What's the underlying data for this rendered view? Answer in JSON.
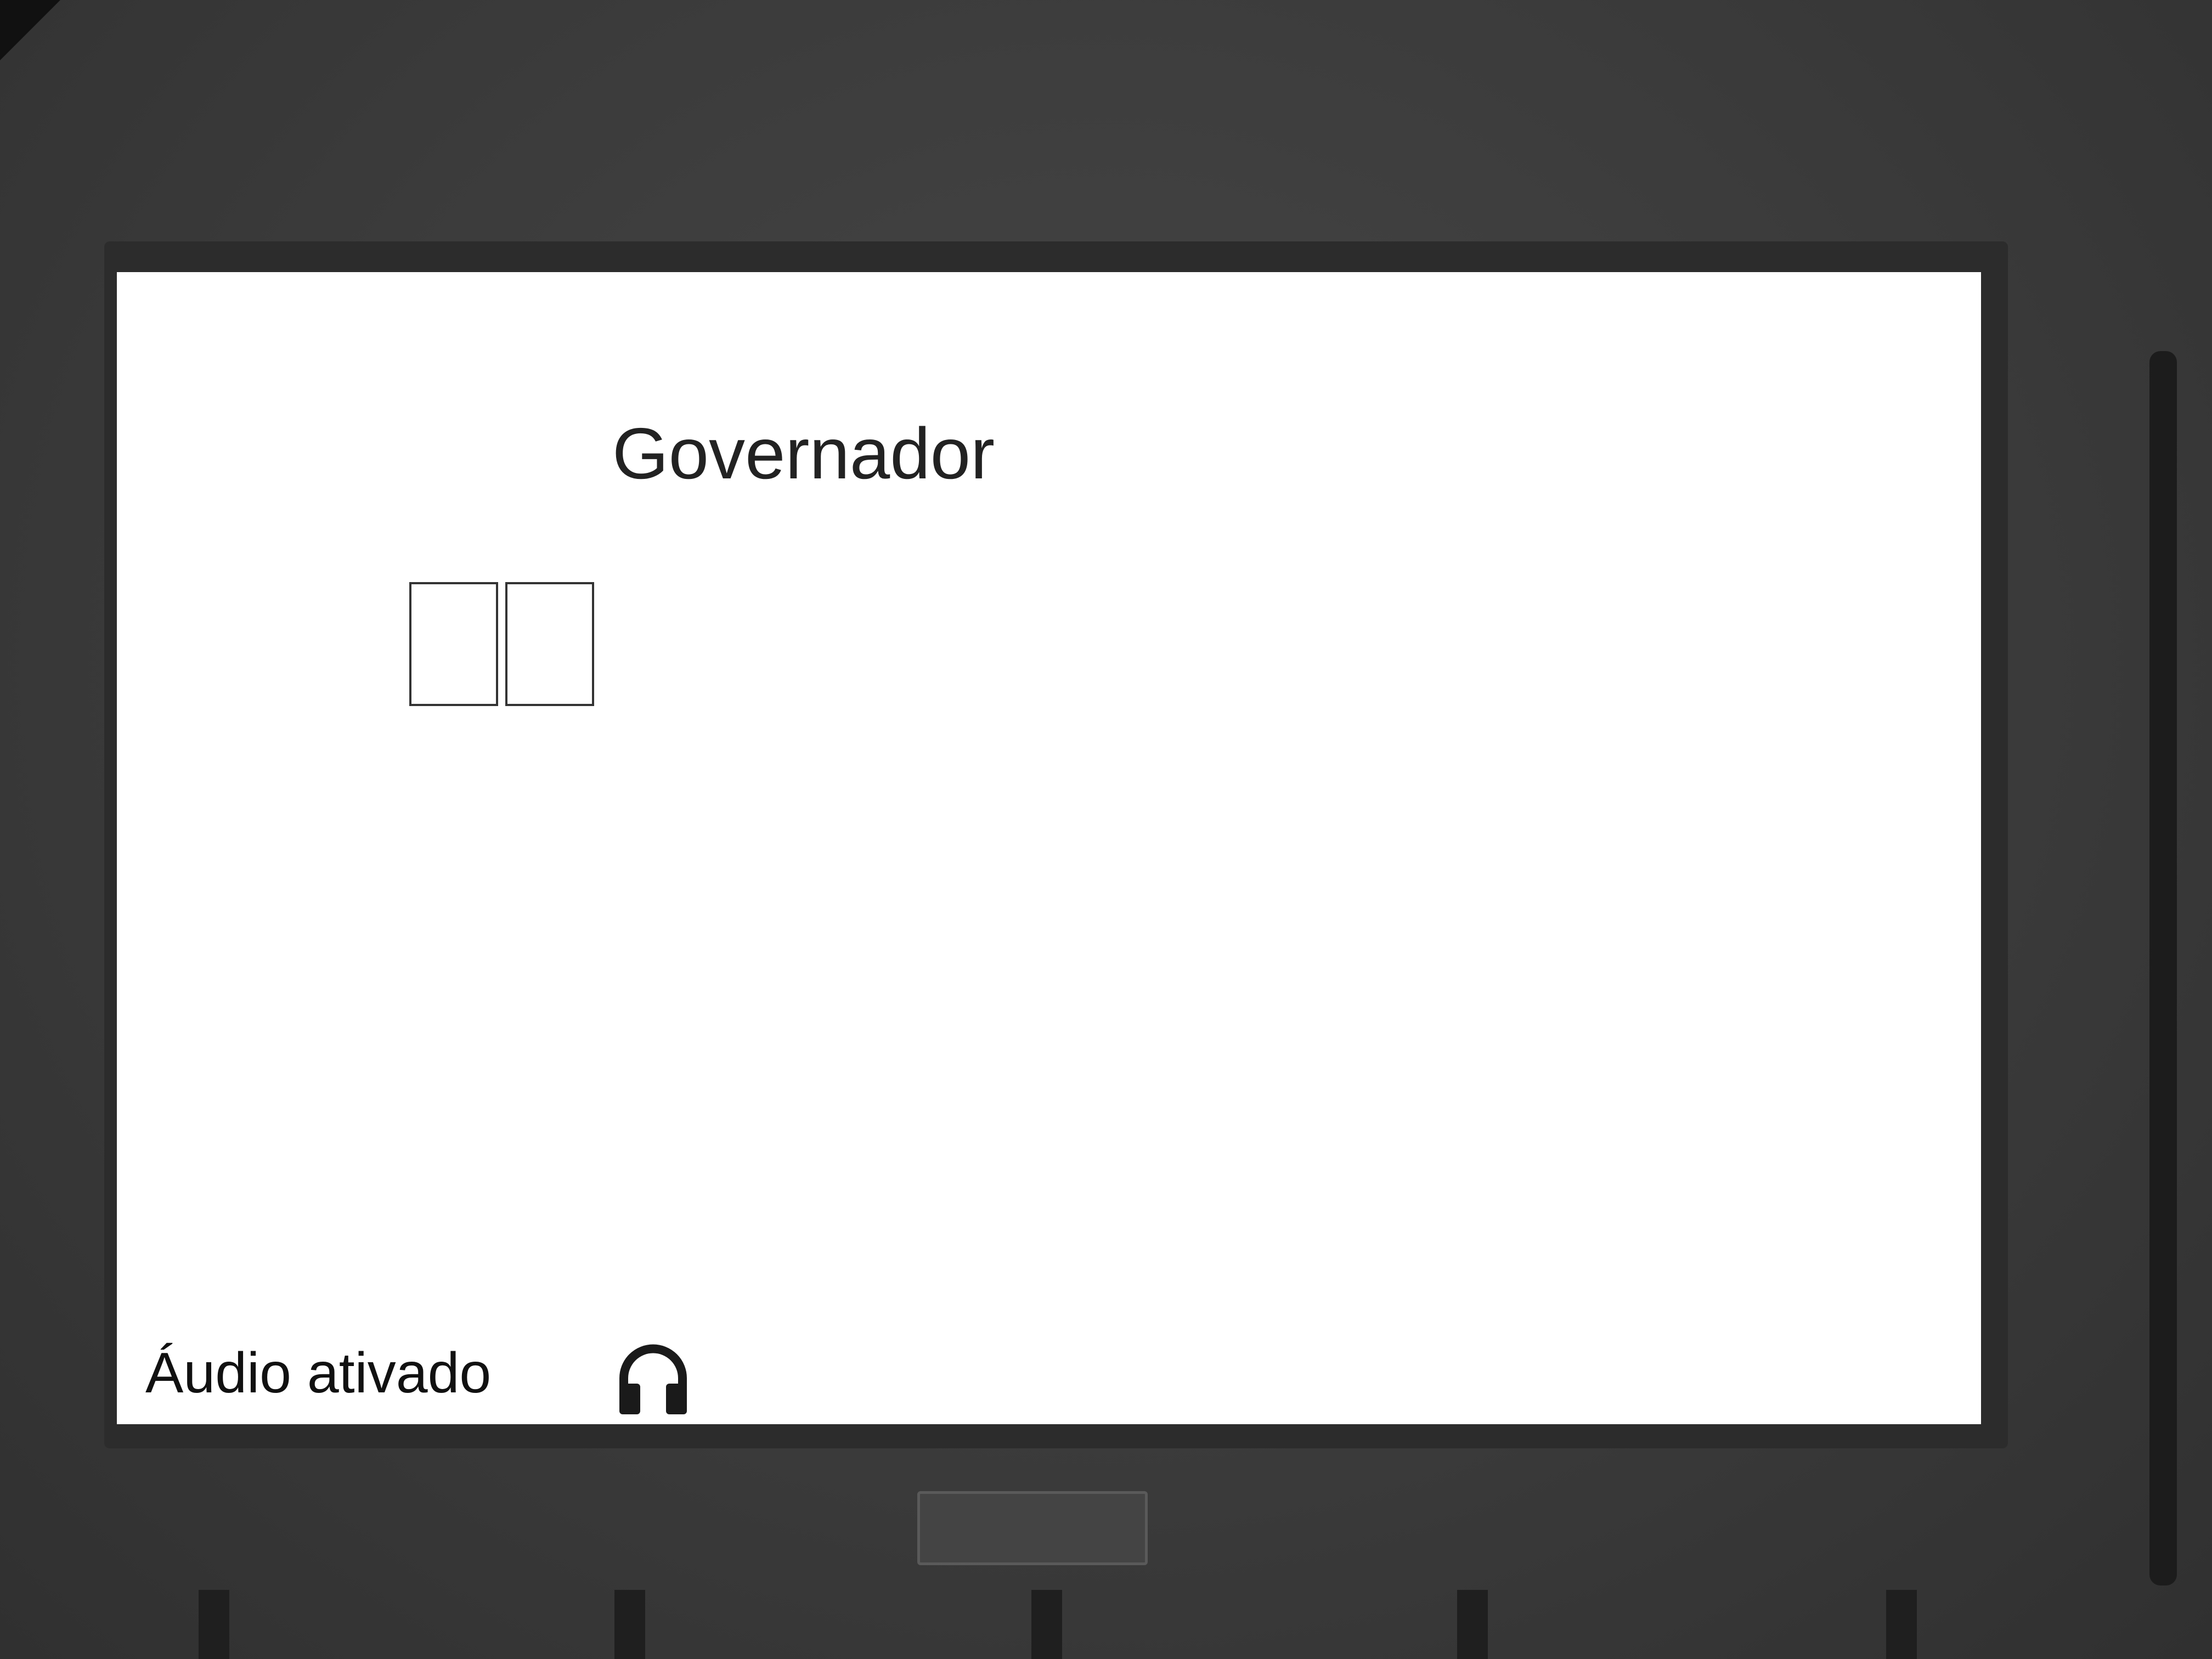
{
  "ballot": {
    "office_title": "Governador",
    "vote_digits": [
      "",
      ""
    ],
    "audio_status": "Áudio ativado"
  },
  "icons": {
    "headphone": "headphone-icon"
  },
  "colors": {
    "screen_background": "#ffffff",
    "text": "#222222",
    "device_body": "#3d3d3d"
  }
}
